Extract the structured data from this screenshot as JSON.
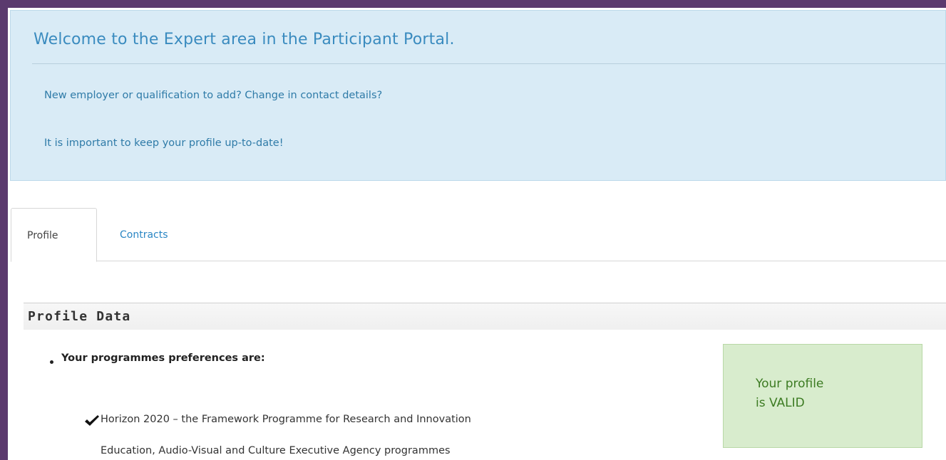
{
  "welcome": {
    "title": "Welcome to the Expert area in the Participant Portal.",
    "line1": "New employer or qualification to add? Change in contact details?",
    "line2": "It is important to keep your profile up-to-date!"
  },
  "tabs": [
    {
      "label": "Profile",
      "active": true
    },
    {
      "label": "Contracts",
      "active": false
    }
  ],
  "section": {
    "title": "Profile Data"
  },
  "preferences": {
    "heading": "Your programmes preferences are:",
    "programmes": [
      "Horizon 2020 – the Framework Programme for Research and Innovation",
      "Education, Audio-Visual and Culture Executive Agency programmes"
    ]
  },
  "status": {
    "line1": "Your profile",
    "line2": "is VALID",
    "color": "#d8eccd"
  },
  "colors": {
    "frame": "#5b3a6e",
    "welcome_bg": "#d9ebf6",
    "link": "#2a86c4"
  }
}
